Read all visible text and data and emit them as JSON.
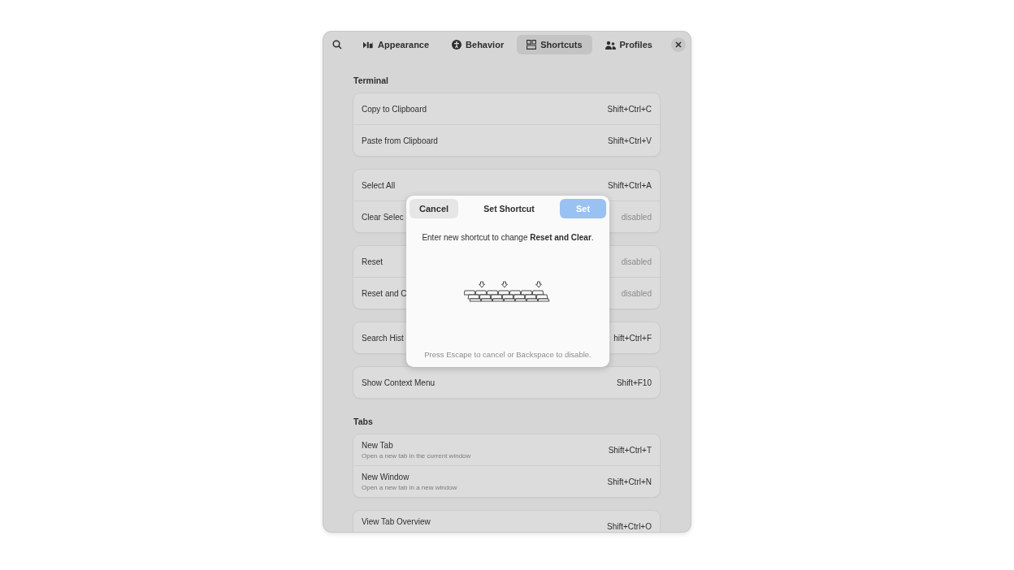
{
  "header": {
    "tabs": [
      {
        "label": "Appearance",
        "selected": false
      },
      {
        "label": "Behavior",
        "selected": false
      },
      {
        "label": "Shortcuts",
        "selected": true
      },
      {
        "label": "Profiles",
        "selected": false
      }
    ]
  },
  "sections": [
    {
      "title": "Terminal",
      "groups": [
        [
          {
            "title": "Copy to Clipboard",
            "shortcut": "Shift+Ctrl+C",
            "disabled": false
          },
          {
            "title": "Paste from Clipboard",
            "shortcut": "Shift+Ctrl+V",
            "disabled": false
          }
        ],
        [
          {
            "title": "Select All",
            "shortcut": "Shift+Ctrl+A",
            "disabled": false
          },
          {
            "title": "Clear Selec",
            "shortcut": "disabled",
            "disabled": true
          }
        ],
        [
          {
            "title": "Reset",
            "shortcut": "disabled",
            "disabled": true
          },
          {
            "title": "Reset and C",
            "shortcut": "disabled",
            "disabled": true
          }
        ],
        [
          {
            "title": "Search Hist",
            "shortcut": "hift+Ctrl+F",
            "disabled": false
          }
        ],
        [
          {
            "title": "Show Context Menu",
            "shortcut": "Shift+F10",
            "disabled": false
          }
        ]
      ]
    },
    {
      "title": "Tabs",
      "groups": [
        [
          {
            "title": "New Tab",
            "subtitle": "Open a new tab in the current window",
            "shortcut": "Shift+Ctrl+T",
            "disabled": false
          },
          {
            "title": "New Window",
            "subtitle": "Open a new tab in a new window",
            "shortcut": "Shift+Ctrl+N",
            "disabled": false
          }
        ],
        [
          {
            "title": "View Tab Overview",
            "shortcut": "Shift+Ctrl+O",
            "disabled": false,
            "kind": "cut"
          }
        ]
      ]
    }
  ],
  "dialog": {
    "cancel": "Cancel",
    "title": "Set Shortcut",
    "set": {
      "label": "Set",
      "disabled": true
    },
    "message": "Enter new shortcut to change **Reset and Clear**.",
    "hint": "Press Escape to cancel or Backspace to disable."
  }
}
